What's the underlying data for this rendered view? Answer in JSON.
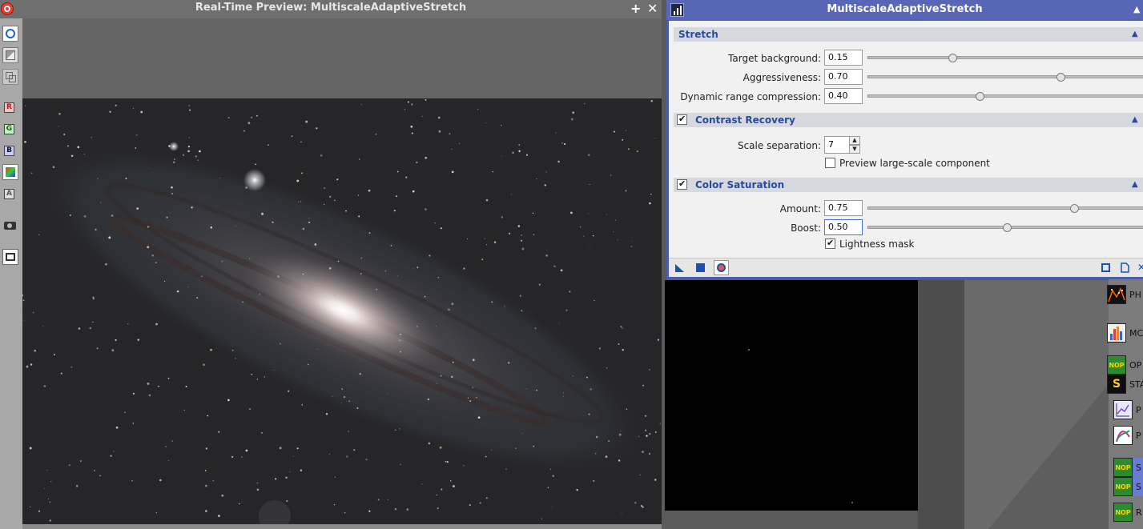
{
  "preview": {
    "title": "Real-Time Preview: MultiscaleAdaptiveStretch",
    "channel_buttons": [
      "R",
      "G",
      "B",
      "A"
    ]
  },
  "dialog": {
    "title": "MultiscaleAdaptiveStretch",
    "stretch": {
      "header": "Stretch",
      "target_background_label": "Target background:",
      "target_background_value": "0.15",
      "aggressiveness_label": "Aggressiveness:",
      "aggressiveness_value": "0.70",
      "drc_label": "Dynamic range compression:",
      "drc_value": "0.40"
    },
    "contrast": {
      "header": "Contrast Recovery",
      "enabled": true,
      "scale_separation_label": "Scale separation:",
      "scale_separation_value": "7",
      "preview_large_label": "Preview large-scale component",
      "preview_large_checked": false
    },
    "color": {
      "header": "Color Saturation",
      "enabled": true,
      "amount_label": "Amount:",
      "amount_value": "0.75",
      "boost_label": "Boost:",
      "boost_value": "0.50",
      "lightness_mask_label": "Lightness mask",
      "lightness_mask_checked": true
    }
  },
  "background_processes": [
    {
      "badge": "",
      "label": "PH"
    },
    {
      "badge": "",
      "label": "MC"
    },
    {
      "badge": "NOP",
      "label": "OP"
    },
    {
      "badge": "S",
      "label": "STA"
    },
    {
      "badge": "",
      "label": "P"
    },
    {
      "badge": "",
      "label": "P"
    },
    {
      "badge": "NOP",
      "label": "S"
    },
    {
      "badge": "NOP",
      "label": "S"
    },
    {
      "badge": "NOP",
      "label": "R"
    }
  ],
  "colors": {
    "dialog_titlebar": "#5767b6",
    "section_text": "#2c4a9a",
    "close_red": "#e83a2e"
  }
}
